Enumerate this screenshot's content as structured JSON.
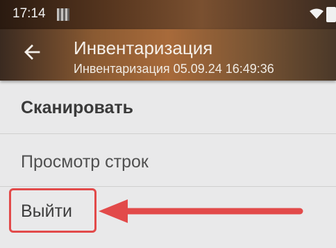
{
  "status_bar": {
    "time": "17:14",
    "icons": [
      "qr-code-icon",
      "wifi-icon",
      "battery-icon"
    ]
  },
  "app_bar": {
    "back_icon": "back-arrow-icon",
    "title": "Инвентаризация",
    "subtitle": "Инвентаризация 05.09.24 16:49:36"
  },
  "menu": {
    "items": [
      {
        "label": "Сканировать"
      },
      {
        "label": "Просмотр строк"
      },
      {
        "label": "Выйти"
      }
    ]
  },
  "annotation": {
    "highlight_color": "#e24a4a",
    "arrow_color": "#e24a4a",
    "points_to": "Выйти"
  }
}
